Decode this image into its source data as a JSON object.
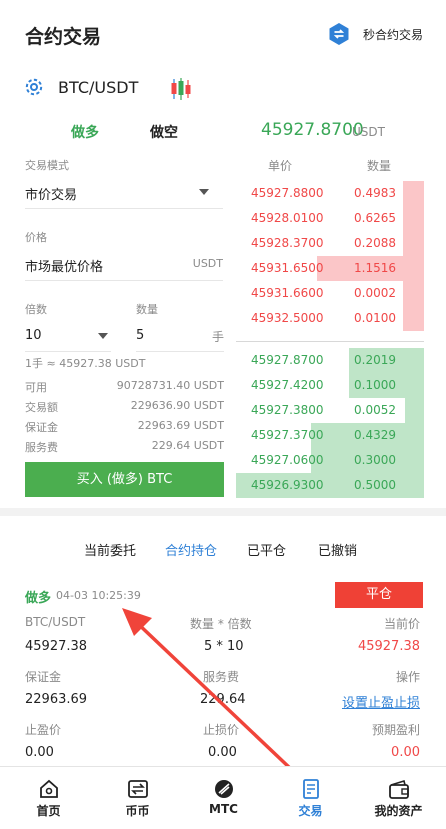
{
  "header": {
    "title": "合约交易",
    "second_contract_label": "秒合约交易"
  },
  "pair": {
    "name": "BTC/USDT"
  },
  "tabs": {
    "long": "做多",
    "short": "做空"
  },
  "ticker": {
    "price": "45927.8700",
    "unit": "USDT"
  },
  "form": {
    "mode_label": "交易模式",
    "mode_value": "市价交易",
    "price_label": "价格",
    "price_value": "市场最优价格",
    "price_unit": "USDT",
    "leverage_label": "倍数",
    "leverage_value": "10",
    "qty_label": "数量",
    "qty_value": "5",
    "qty_unit": "手",
    "lot_note": "1手 ≈ 45927.38 USDT",
    "available_label": "可用",
    "available_value": "90728731.40 USDT",
    "volume_label": "交易额",
    "volume_value": "229636.90 USDT",
    "margin_label": "保证金",
    "margin_value": "22963.69 USDT",
    "fee_label": "服务费",
    "fee_value": "229.64 USDT",
    "buy_button": "买入 (做多) BTC"
  },
  "orderbook": {
    "price_header": "单价",
    "qty_header": "数量",
    "asks": [
      {
        "price": "45927.8800",
        "qty": "0.4983",
        "depth": 0.11
      },
      {
        "price": "45928.0100",
        "qty": "0.6265",
        "depth": 0.11
      },
      {
        "price": "45928.3700",
        "qty": "0.2088",
        "depth": 0.11
      },
      {
        "price": "45931.6500",
        "qty": "1.1516",
        "depth": 0.57
      },
      {
        "price": "45931.6600",
        "qty": "0.0002",
        "depth": 0.11
      },
      {
        "price": "45932.5000",
        "qty": "0.0100",
        "depth": 0.11
      }
    ],
    "bids": [
      {
        "price": "45927.8700",
        "qty": "0.2019",
        "depth": 0.4
      },
      {
        "price": "45927.4200",
        "qty": "0.1000",
        "depth": 0.4
      },
      {
        "price": "45927.3800",
        "qty": "0.0052",
        "depth": 0.1
      },
      {
        "price": "45927.3700",
        "qty": "0.4329",
        "depth": 0.6
      },
      {
        "price": "45927.0600",
        "qty": "0.3000",
        "depth": 0.6
      },
      {
        "price": "45926.9300",
        "qty": "0.5000",
        "depth": 1.0
      }
    ]
  },
  "order_tabs": {
    "current": "当前委托",
    "holding": "合约持仓",
    "closed": "已平仓",
    "cancelled": "已撤销"
  },
  "position": {
    "side": "做多",
    "time": "04-03 10:25:39",
    "close_button": "平仓",
    "pair_label": "BTC/USDT",
    "pair_value": "45927.38",
    "qty_label": "数量 * 倍数",
    "qty_value": "5 * 10",
    "current_label": "当前价",
    "current_value": "45927.38",
    "margin_label": "保证金",
    "margin_value": "22963.69",
    "fee_label": "服务费",
    "fee_value": "229.64",
    "op_label": "操作",
    "op_link": "设置止盈止损",
    "tp_label": "止盈价",
    "tp_value": "0.00",
    "sl_label": "止损价",
    "sl_value": "0.00",
    "pnl_label": "预期盈利",
    "pnl_value": "0.00"
  },
  "nav": {
    "home": "首页",
    "coin": "币币",
    "mtc": "MTC",
    "trade": "交易",
    "assets": "我的资产"
  },
  "colors": {
    "green": "#3aa757",
    "red": "#f04848",
    "ask_depth": "#fbc6c8",
    "bid_depth": "#bfe5c8",
    "accent_blue": "#2f80d6",
    "buy_button": "#4bae4f",
    "close_button": "#ef4136"
  },
  "icons": [
    "swap-icon",
    "settings-icon",
    "candlestick-icon",
    "dropdown-arrow-icon",
    "home-icon",
    "coin-icon",
    "mtc-icon",
    "trade-icon",
    "wallet-icon",
    "annotation-arrow"
  ]
}
